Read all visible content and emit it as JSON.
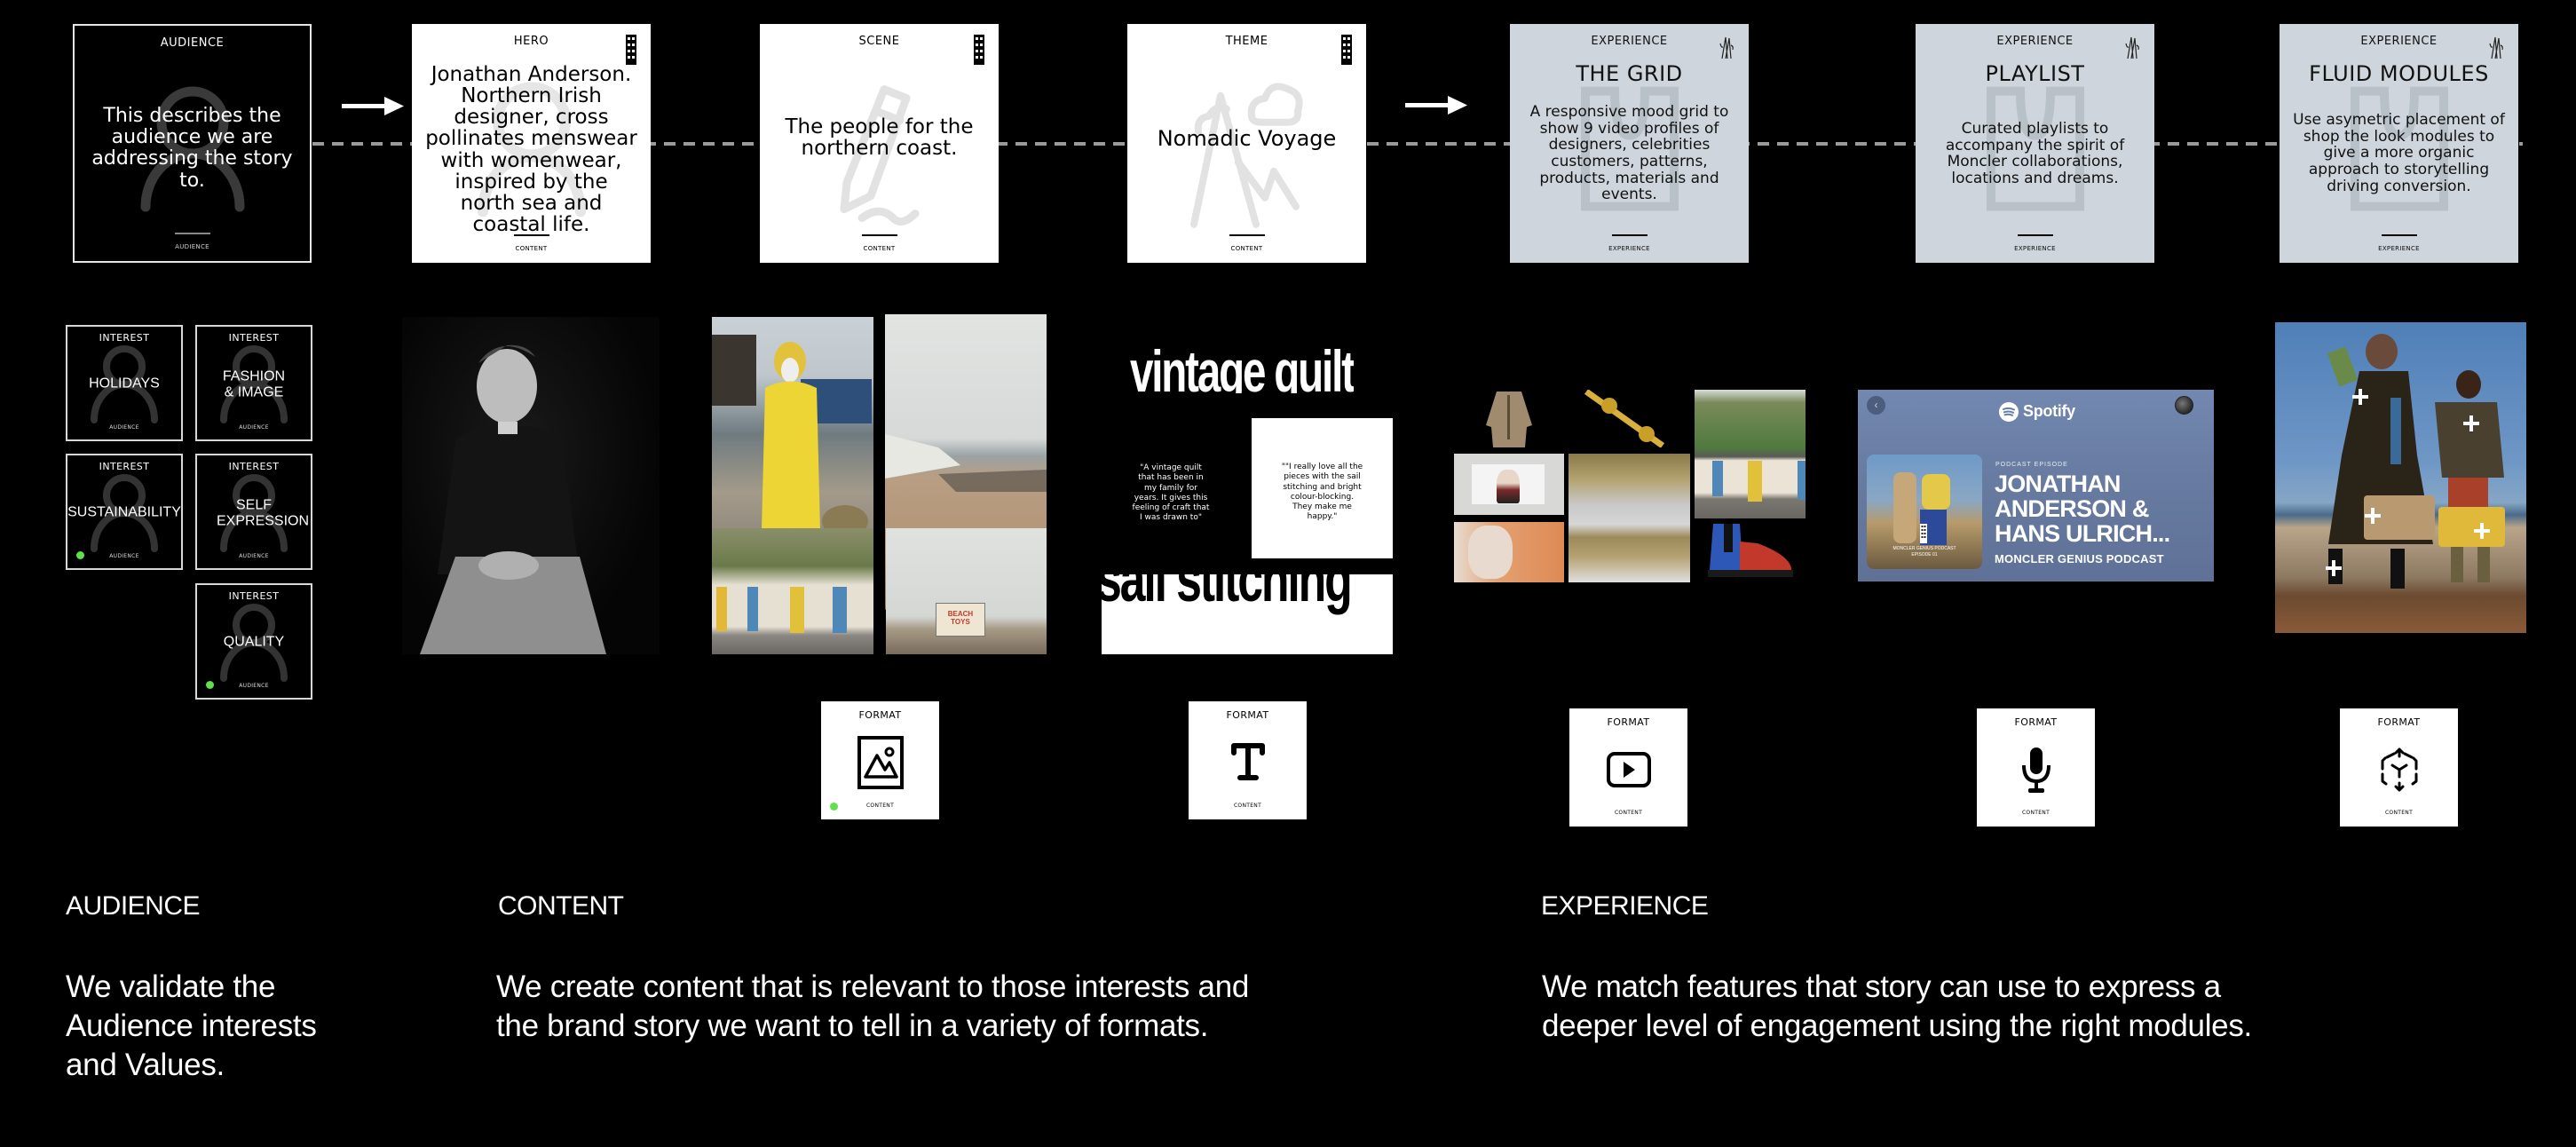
{
  "story_cards": [
    {
      "kicker": "AUDIENCE",
      "title": "",
      "body": "This describes the audience we are addressing the story to.",
      "footer": "AUDIENCE",
      "bg_icon": "person-icon",
      "theme": "dark"
    },
    {
      "kicker": "HERO",
      "title": "",
      "body": "Jonathan Anderson. Northern Irish designer, cross pollinates menswear with womenwear, inspired by the north sea and coastal life.",
      "footer": "CONTENT",
      "bg_icon": "person-icon",
      "theme": "white"
    },
    {
      "kicker": "SCENE",
      "title": "",
      "body": "The people for the northern coast.",
      "footer": "CONTENT",
      "bg_icon": "pencil-icon",
      "theme": "white"
    },
    {
      "kicker": "THEME",
      "title": "",
      "body": "Nomadic Voyage",
      "footer": "CONTENT",
      "bg_icon": "mountain-cloud-icon",
      "theme": "white"
    },
    {
      "kicker": "EXPERIENCE",
      "title": "THE GRID",
      "body": "A responsive mood grid to show 9 video profiles of designers, celebrities customers, patterns, products, materials and events.",
      "footer": "EXPERIENCE",
      "bg_icon": "puzzle-icon",
      "theme": "grey"
    },
    {
      "kicker": "EXPERIENCE",
      "title": "PLAYLIST",
      "body": "Curated playlists to accompany the spirit of Moncler collaborations, locations and dreams.",
      "footer": "EXPERIENCE",
      "bg_icon": "puzzle-icon",
      "theme": "grey"
    },
    {
      "kicker": "EXPERIENCE",
      "title": "FLUID MODULES",
      "body": "Use asymetric placement of shop the look modules to give a more organic approach to storytelling driving conversion.",
      "footer": "EXPERIENCE",
      "bg_icon": "puzzle-icon",
      "theme": "grey"
    }
  ],
  "interests": [
    {
      "kicker": "INTEREST",
      "label": "HOLIDAYS",
      "footer": "AUDIENCE",
      "validated": false
    },
    {
      "kicker": "INTEREST",
      "label": "FASHION & IMAGE",
      "footer": "AUDIENCE",
      "validated": false
    },
    {
      "kicker": "INTEREST",
      "label": "SUSTAINABILITY",
      "footer": "AUDIENCE",
      "validated": true
    },
    {
      "kicker": "INTEREST",
      "label": "SELF EXPRESSION",
      "footer": "AUDIENCE",
      "validated": false
    },
    {
      "kicker": "INTEREST",
      "label": "QUALITY",
      "footer": "AUDIENCE",
      "validated": true
    }
  ],
  "quilt": {
    "headline_top": "vintage quilt",
    "headline_bottom": "sail stitching",
    "quote_left": "\"A vintage quilt that has been in my family for years. It gives this feeling of craft that I was drawn to\"",
    "quote_right": "\"\"I really love all the pieces with the sail stitching and bright colour-blocking. They make me happy.\""
  },
  "photo_grid": {
    "beach_sign": "BEACH TOYS"
  },
  "spotify": {
    "brand": "Spotify",
    "eyebrow": "PODCAST EPISODE",
    "title_lines": [
      "JONATHAN",
      "ANDERSON &",
      "HANS ULRICH..."
    ],
    "show": "MONCLER GENIUS PODCAST",
    "cover_caption_1": "MONCLER GENIUS PODCAST",
    "cover_caption_2": "EPISODE 01"
  },
  "formats": [
    {
      "kicker": "FORMAT",
      "icon": "image-icon",
      "footer": "CONTENT",
      "validated": true
    },
    {
      "kicker": "FORMAT",
      "icon": "text-icon",
      "footer": "CONTENT",
      "validated": false
    },
    {
      "kicker": "FORMAT",
      "icon": "video-play-icon",
      "footer": "CONTENT",
      "validated": false
    },
    {
      "kicker": "FORMAT",
      "icon": "microphone-icon",
      "footer": "CONTENT",
      "validated": false
    },
    {
      "kicker": "FORMAT",
      "icon": "3d-cube-icon",
      "footer": "CONTENT",
      "validated": false
    }
  ],
  "sections": [
    {
      "title": "AUDIENCE",
      "body": "We validate the Audience interests and Values."
    },
    {
      "title": "CONTENT",
      "body": "We create content that is relevant to those interests and the brand story we want to tell in a variety of formats."
    },
    {
      "title": "EXPERIENCE",
      "body": "We match features that story can use to express a deeper level of engagement using the right modules."
    }
  ],
  "colors": {
    "validated_dot": "#5ee14a",
    "experience_card": "#cfd5dc",
    "connector": "#9a9a9a"
  }
}
